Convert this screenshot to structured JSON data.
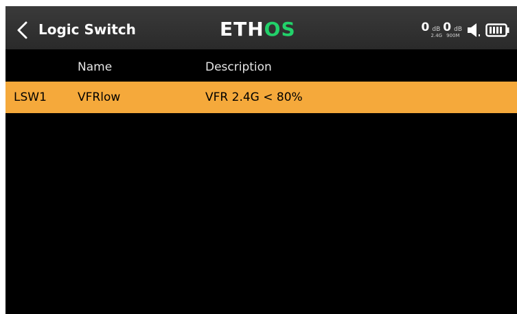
{
  "header": {
    "title": "Logic Switch",
    "logo_main": "ETH",
    "logo_accent": "OS"
  },
  "status": {
    "rf1_value": "0",
    "rf1_unit": "dB",
    "rf2_value": "0",
    "rf2_unit": "dB",
    "rf1_label": "2.4G",
    "rf2_label": "900M",
    "icons": [
      "volume-icon",
      "battery-icon"
    ]
  },
  "table": {
    "columns": [
      "",
      "Name",
      "Description"
    ],
    "rows": [
      {
        "id": "LSW1",
        "name": "VFRlow",
        "description": "VFR 2.4G < 80%"
      }
    ]
  },
  "colors": {
    "accent_row": "#f5a93b",
    "logo_accent": "#22d16a",
    "background": "#000000"
  }
}
